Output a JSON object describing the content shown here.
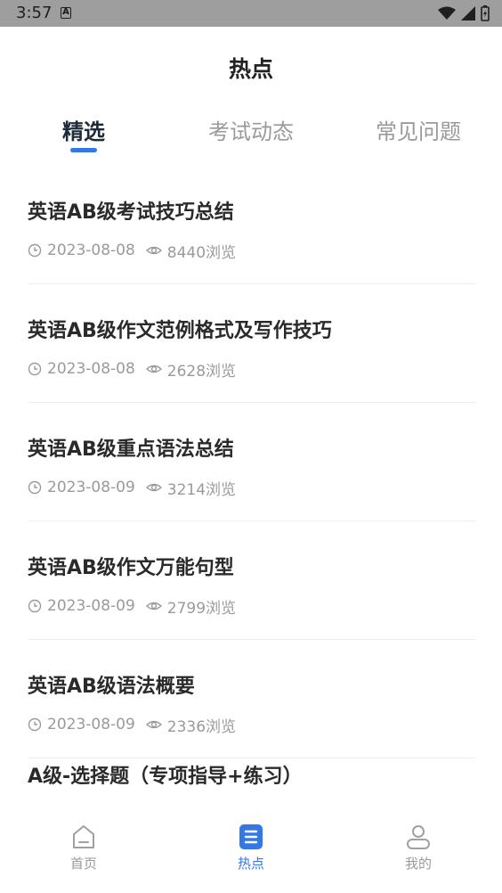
{
  "status_bar": {
    "time": "3:57",
    "notif_letter": "A"
  },
  "header": {
    "title": "热点"
  },
  "tabs": [
    {
      "label": "精选",
      "active": true
    },
    {
      "label": "考试动态",
      "active": false
    },
    {
      "label": "常见问题",
      "active": false
    }
  ],
  "articles": [
    {
      "title": "英语AB级考试技巧总结",
      "date": "2023-08-08",
      "views": "8440浏览"
    },
    {
      "title": "英语AB级作文范例格式及写作技巧",
      "date": "2023-08-08",
      "views": "2628浏览"
    },
    {
      "title": "英语AB级重点语法总结",
      "date": "2023-08-09",
      "views": "3214浏览"
    },
    {
      "title": "英语AB级作文万能句型",
      "date": "2023-08-09",
      "views": "2799浏览"
    },
    {
      "title": "英语AB级语法概要",
      "date": "2023-08-09",
      "views": "2336浏览"
    },
    {
      "title": "A级-选择题（专项指导+练习）",
      "date": "",
      "views": ""
    }
  ],
  "bottom_nav": [
    {
      "label": "首页",
      "icon": "home-icon",
      "active": false
    },
    {
      "label": "热点",
      "icon": "document-icon",
      "active": true
    },
    {
      "label": "我的",
      "icon": "profile-icon",
      "active": false
    }
  ],
  "colors": {
    "accent": "#3478e5",
    "muted": "#9a9a9a",
    "statusbar": "#9e9e9e"
  }
}
